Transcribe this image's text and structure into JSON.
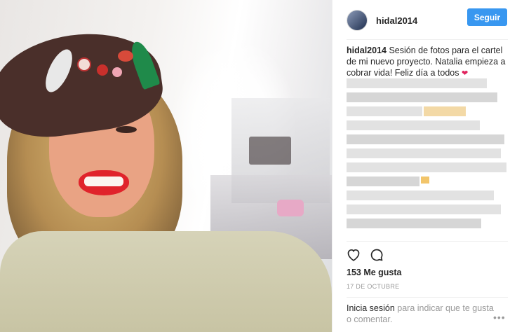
{
  "post": {
    "username": "hidal2014",
    "follow_label": "Seguir",
    "caption_user": "hidal2014",
    "caption_text": "Sesión de fotos para el cartel de mi nuevo proyecto. Natalia empieza a cobrar vida! Feliz día a todos",
    "caption_emoji": "❤",
    "likes_text": "153 Me gusta",
    "date_text": "17 DE OCTUBRE",
    "login_link": "Inicia sesión",
    "login_text": " para indicar que te gusta o comentar.",
    "more_label": "•••"
  },
  "icons": {
    "like": "heart-outline-icon",
    "comment": "comment-bubble-icon",
    "more": "more-options-icon"
  },
  "colors": {
    "follow_button": "#3897f0",
    "text_primary": "#262626",
    "text_secondary": "#999999",
    "divider": "#efefef"
  }
}
